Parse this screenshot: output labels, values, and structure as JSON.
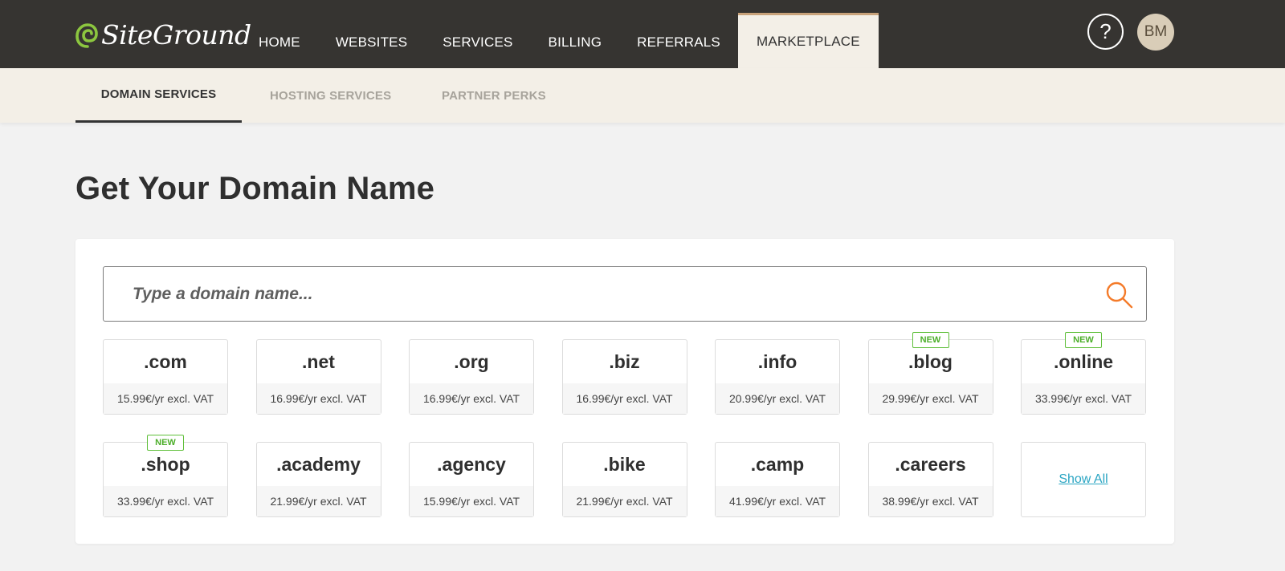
{
  "brand": {
    "name": "SiteGround"
  },
  "nav": {
    "items": [
      {
        "label": "HOME"
      },
      {
        "label": "WEBSITES"
      },
      {
        "label": "SERVICES"
      },
      {
        "label": "BILLING"
      },
      {
        "label": "REFERRALS"
      },
      {
        "label": "MARKETPLACE"
      }
    ],
    "active": "MARKETPLACE",
    "help_label": "?",
    "avatar_initials": "BM"
  },
  "subnav": {
    "items": [
      {
        "label": "DOMAIN SERVICES"
      },
      {
        "label": "HOSTING SERVICES"
      },
      {
        "label": "PARTNER PERKS"
      }
    ],
    "active": "DOMAIN SERVICES"
  },
  "page": {
    "title": "Get Your Domain Name",
    "search_placeholder": "Type a domain name...",
    "show_all_label": "Show All",
    "badge_label": "NEW"
  },
  "tlds": [
    {
      "name": ".com",
      "price": "15.99€/yr excl. VAT",
      "is_new": false
    },
    {
      "name": ".net",
      "price": "16.99€/yr excl. VAT",
      "is_new": false
    },
    {
      "name": ".org",
      "price": "16.99€/yr excl. VAT",
      "is_new": false
    },
    {
      "name": ".biz",
      "price": "16.99€/yr excl. VAT",
      "is_new": false
    },
    {
      "name": ".info",
      "price": "20.99€/yr excl. VAT",
      "is_new": false
    },
    {
      "name": ".blog",
      "price": "29.99€/yr excl. VAT",
      "is_new": true
    },
    {
      "name": ".online",
      "price": "33.99€/yr excl. VAT",
      "is_new": true
    },
    {
      "name": ".shop",
      "price": "33.99€/yr excl. VAT",
      "is_new": true
    },
    {
      "name": ".academy",
      "price": "21.99€/yr excl. VAT",
      "is_new": false
    },
    {
      "name": ".agency",
      "price": "15.99€/yr excl. VAT",
      "is_new": false
    },
    {
      "name": ".bike",
      "price": "21.99€/yr excl. VAT",
      "is_new": false
    },
    {
      "name": ".camp",
      "price": "41.99€/yr excl. VAT",
      "is_new": false
    },
    {
      "name": ".careers",
      "price": "38.99€/yr excl. VAT",
      "is_new": false
    }
  ],
  "colors": {
    "topbar": "#363431",
    "subbar": "#f3efe7",
    "accent_tab": "#c8a27a",
    "search_icon": "#f47b2a",
    "new_badge": "#4cae2a",
    "link": "#2aa5c3",
    "logo_green": "#8cc63f"
  },
  "icons": {
    "logo": "siteground-swirl-icon",
    "search": "search-icon",
    "help": "question-icon"
  }
}
